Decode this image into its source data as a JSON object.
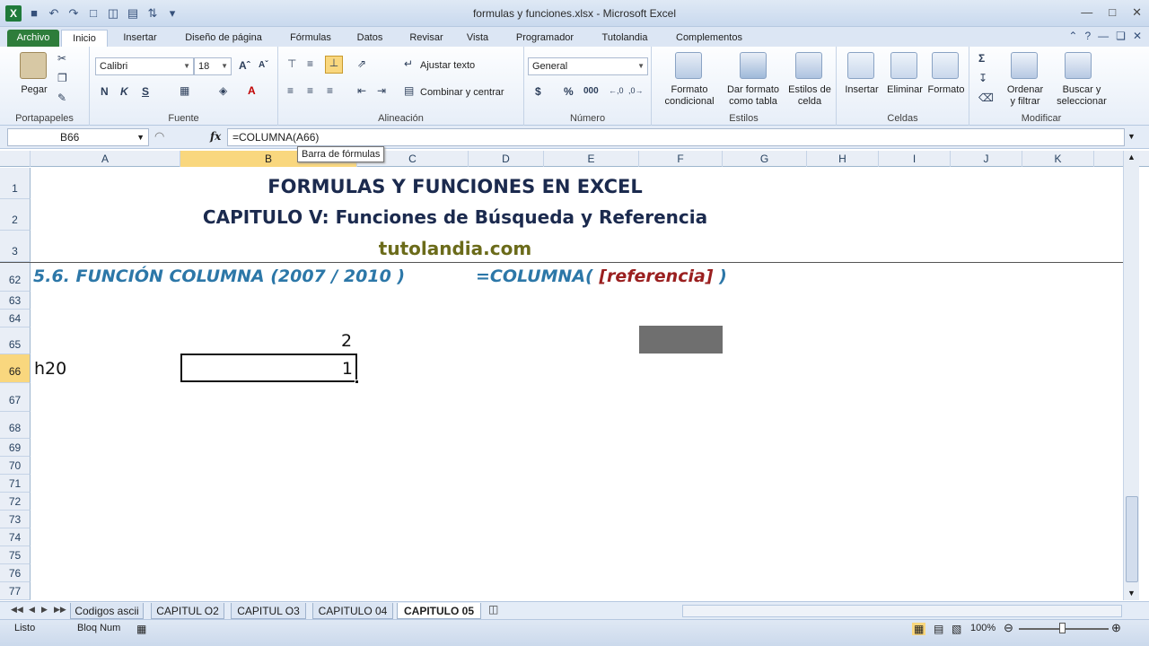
{
  "window": {
    "title": "formulas y funciones.xlsx - Microsoft Excel"
  },
  "ribbon": {
    "tabs": [
      "Archivo",
      "Inicio",
      "Insertar",
      "Diseño de página",
      "Fórmulas",
      "Datos",
      "Revisar",
      "Vista",
      "Programador",
      "Tutolandia",
      "Complementos"
    ],
    "active_tab": "Inicio",
    "clipboard": {
      "paste": "Pegar",
      "label": "Portapapeles"
    },
    "font": {
      "name": "Calibri",
      "size": "18",
      "bold": "N",
      "italic": "K",
      "underline": "S",
      "label": "Fuente"
    },
    "alignment": {
      "wrap": "Ajustar texto",
      "merge": "Combinar y centrar",
      "label": "Alineación"
    },
    "number": {
      "format": "General",
      "label": "Número"
    },
    "styles": {
      "conditional": [
        "Formato",
        "condicional"
      ],
      "table": [
        "Dar formato",
        "como tabla"
      ],
      "cell": [
        "Estilos de",
        "celda"
      ],
      "label": "Estilos"
    },
    "cells": {
      "insert": "Insertar",
      "delete": "Eliminar",
      "format": "Formato",
      "label": "Celdas"
    },
    "editing": {
      "sort": [
        "Ordenar",
        "y filtrar"
      ],
      "find": [
        "Buscar y",
        "seleccionar"
      ],
      "label": "Modificar"
    }
  },
  "formula_bar": {
    "name_box": "B66",
    "fx": "fx",
    "formula": "=COLUMNA(A66)",
    "tooltip": "Barra de fórmulas"
  },
  "columns": [
    "A",
    "B",
    "C",
    "D",
    "E",
    "F",
    "G",
    "H",
    "I",
    "J",
    "K"
  ],
  "selected_column": "B",
  "rows": [
    "1",
    "2",
    "3",
    "62",
    "63",
    "64",
    "65",
    "66",
    "67",
    "68",
    "69",
    "70",
    "71",
    "72",
    "73",
    "74",
    "75",
    "76",
    "77"
  ],
  "selected_row": "66",
  "content": {
    "title1": "FORMULAS Y FUNCIONES EN EXCEL",
    "title2": "CAPITULO V: Funciones de Búsqueda y Referencia",
    "title3": "tutolandia.com",
    "section": "5.6. FUNCIÓN COLUMNA (2007 / 2010 )",
    "syntax_prefix": "=COLUMNA(",
    "syntax_arg": " [referencia] ",
    "syntax_suffix": ")",
    "b65": "2",
    "a66": "h20",
    "b66": "1"
  },
  "sheet_tabs": [
    "Codigos ascii",
    "CAPITUL O2",
    "CAPITUL O3",
    "CAPITULO 04",
    "CAPITULO 05"
  ],
  "active_sheet": "CAPITULO 05",
  "status": {
    "ready": "Listo",
    "numlock": "Bloq Num",
    "zoom": "100%"
  },
  "colors": {
    "accent_green": "#2e7d3b",
    "selection": "#f9d77e",
    "section_blue": "#2c77a8",
    "ref_red": "#9a1f1f",
    "title_navy": "#1b2a4e",
    "site_olive": "#6b6b1a"
  }
}
